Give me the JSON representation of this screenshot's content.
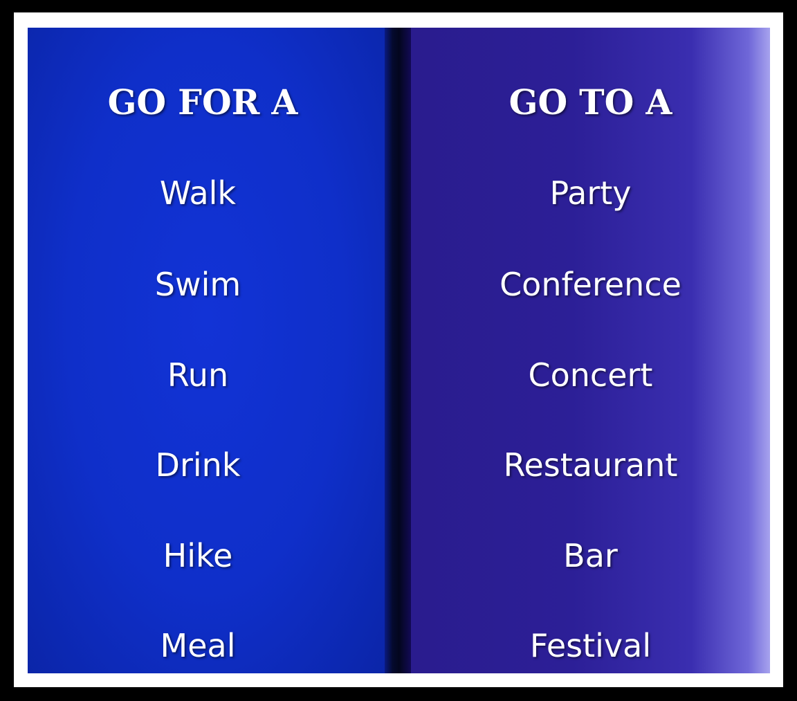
{
  "left_column": {
    "heading": "GO FOR A",
    "items": [
      "Walk",
      "Swim",
      "Run",
      "Drink",
      "Hike",
      "Meal"
    ]
  },
  "right_column": {
    "heading": "GO TO A",
    "items": [
      "Party",
      "Conference",
      "Concert",
      "Restaurant",
      "Bar",
      "Festival"
    ]
  },
  "colors": {
    "left_background": "#0f2fc9",
    "right_background": "#2c1f97",
    "divider": "#03061e",
    "frame": "#000000",
    "mat": "#ffffff",
    "text": "#ffffff"
  }
}
